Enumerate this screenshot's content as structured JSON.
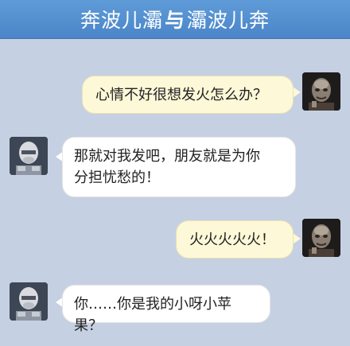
{
  "header": {
    "title_left": "奔波儿灞",
    "title_sep": "与",
    "title_right": "灞波儿奔"
  },
  "messages": [
    {
      "side": "right",
      "text": "心情不好很想发火怎么办？"
    },
    {
      "side": "left",
      "line1": "那就对我发吧，朋友就是为你",
      "line2": "分担忧愁的！"
    },
    {
      "side": "right",
      "text": "火火火火火！"
    },
    {
      "side": "left",
      "text": "你……你是我的小呀小苹果？"
    }
  ],
  "colors": {
    "background": "#c6d0e3",
    "header": "#4a86c8",
    "bubble_right": "#fdf8d7",
    "bubble_left": "#ffffff"
  },
  "avatars": {
    "right": "dark-ghoul-avatar-icon",
    "left": "armored-soldier-avatar-icon"
  }
}
